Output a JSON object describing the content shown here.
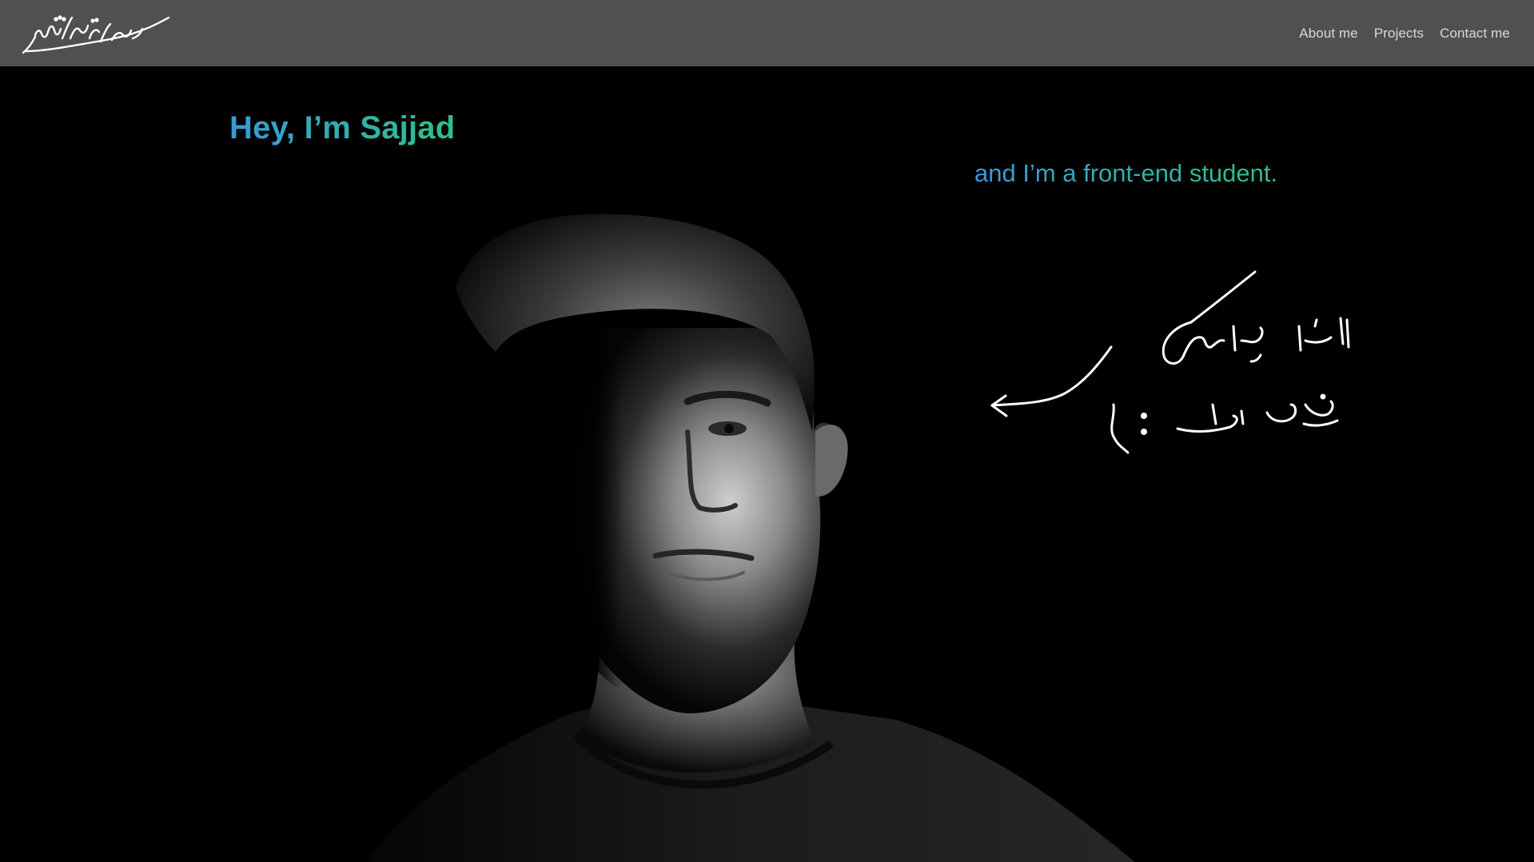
{
  "header": {
    "logo_name": "signature-logo",
    "nav": [
      {
        "label": "About me"
      },
      {
        "label": "Projects"
      },
      {
        "label": "Contact me"
      }
    ]
  },
  "hero": {
    "title": "Hey, I’m Sajjad",
    "subtitle": "and I’m a front-end student."
  },
  "colors": {
    "navbar_bg": "#505050",
    "page_bg": "#000000",
    "gradient_start": "#3a98d8",
    "gradient_end": "#2fbf8c",
    "nav_text": "#d8d8d8"
  },
  "handwritten_note": {
    "line1": "البته این عکس",
    "line2": "من نیست :)",
    "arrow_icon": "arrow-left-icon"
  }
}
